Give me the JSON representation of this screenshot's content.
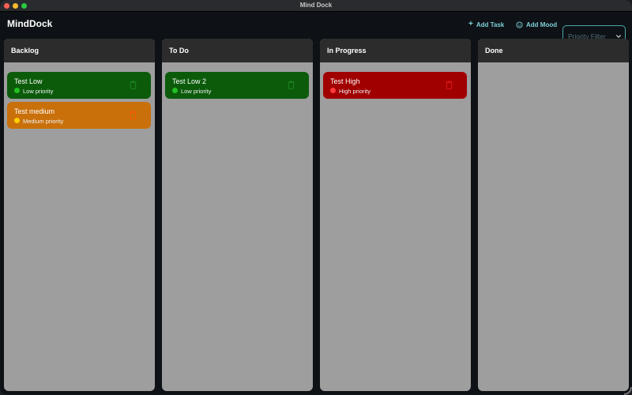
{
  "window": {
    "title": "Mind Dock"
  },
  "header": {
    "app_title": "MindDock",
    "add_task_label": "Add Task",
    "add_mood_label": "Add Mood",
    "priority_filter_placeholder": "Priority Filter"
  },
  "colors": {
    "accent": "#7fd0d8",
    "low_card": "#0b5b0b",
    "low_dot": "#22c022",
    "medium_card": "#c9700b",
    "medium_dot": "#ffcc00",
    "high_card": "#a10000",
    "high_dot": "#ff3b3b",
    "column_bg": "#9e9e9e",
    "column_header": "#2c2c2c"
  },
  "columns": [
    {
      "title": "Backlog",
      "cards": [
        {
          "title": "Test Low",
          "priority": "Low priority",
          "level": "low"
        },
        {
          "title": "Test medium",
          "priority": "Medium priority",
          "level": "medium"
        }
      ]
    },
    {
      "title": "To Do",
      "cards": [
        {
          "title": "Test Low 2",
          "priority": "Low priority",
          "level": "low"
        }
      ]
    },
    {
      "title": "In Progress",
      "cards": [
        {
          "title": "Test High",
          "priority": "High priority",
          "level": "high"
        }
      ]
    },
    {
      "title": "Done",
      "cards": []
    }
  ]
}
